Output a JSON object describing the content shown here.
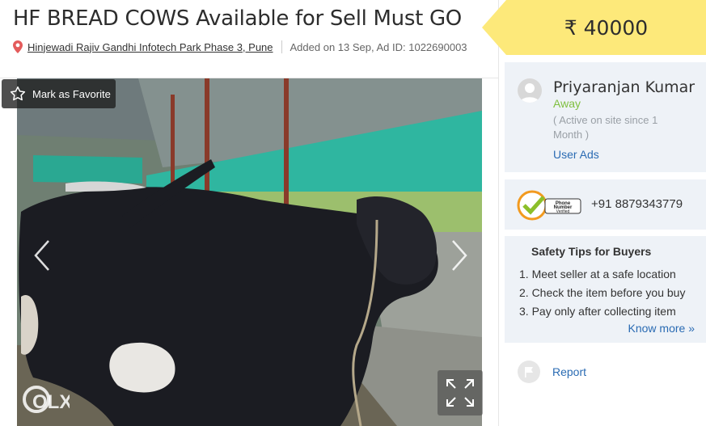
{
  "ad": {
    "title": "HF BREAD COWS Available for Sell Must GO",
    "location": "Hinjewadi Rajiv Gandhi Infotech Park Phase 3, Pune",
    "added": "Added on 13 Sep, Ad ID: 1022690003",
    "price": "₹ 40000"
  },
  "photo": {
    "favorite_label": "Mark as Favorite",
    "watermark": "OLX"
  },
  "seller": {
    "name": "Priyaranjan Kumar",
    "status": "Away",
    "active_since": "( Active on site since 1 Month )",
    "user_ads_link": "User Ads",
    "phone": "+91 8879343779",
    "phone_badge": "Phone Number Verified"
  },
  "safety": {
    "title": "Safety Tips for Buyers",
    "tips": [
      "1. Meet seller at a safe location",
      "2. Check the item before you buy",
      "3. Pay only after collecting item"
    ],
    "know_more": "Know more »"
  },
  "report_label": "Report",
  "colors": {
    "price_banner": "#fde97a",
    "link": "#2a6bb3",
    "away_status": "#7fbf3f",
    "card_bg": "#eef2f7"
  }
}
